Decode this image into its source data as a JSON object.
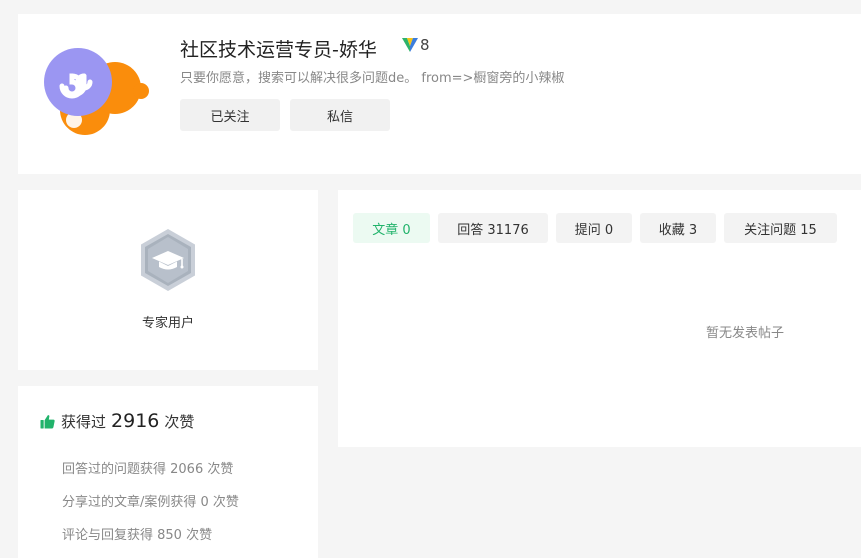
{
  "profile": {
    "username": "社区技术运营专员-娇华",
    "vip_level": "8",
    "bio": "只要你愿意，搜索可以解决很多问题de。 from=>橱窗旁的小辣椒",
    "follow_label": "已关注",
    "message_label": "私信",
    "avatar_icon": "mini-program-logo-icon",
    "colors": {
      "avatar_purple": "#9b96f2",
      "avatar_orange": "#fa8d0c"
    }
  },
  "expert": {
    "label": "专家用户",
    "badge_icon": "graduation-cap-hexagon-icon"
  },
  "likes": {
    "prefix": "获得过",
    "total": "2916",
    "suffix": "次赞",
    "thumb_color": "#21b36b",
    "details": {
      "answers": "回答过的问题获得 2066 次赞",
      "articles": "分享过的文章/案例获得 0 次赞",
      "comments": "评论与回复获得 850 次赞"
    }
  },
  "tabs": {
    "articles": "文章 0",
    "answers": "回答 31176",
    "questions": "提问 0",
    "favorites": "收藏 3",
    "followed_questions": "关注问题 15",
    "active": "articles",
    "active_color": "#21b36b"
  },
  "content": {
    "empty_text": "暂无发表帖子"
  }
}
